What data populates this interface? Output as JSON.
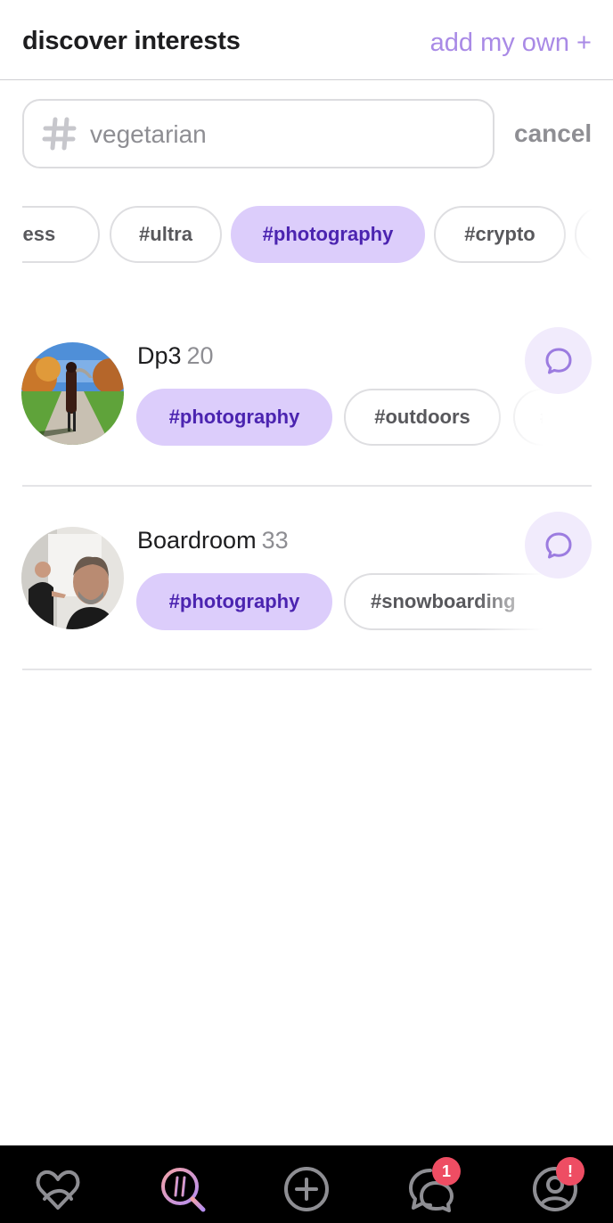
{
  "header": {
    "title": "discover interests",
    "add_own": "add my own +"
  },
  "search": {
    "value": "vegetarian",
    "icon": "hash-icon",
    "cancel": "cancel"
  },
  "filter_chips": [
    {
      "label": "tness",
      "active": false
    },
    {
      "label": "#ultra",
      "active": false
    },
    {
      "label": "#photography",
      "active": true
    },
    {
      "label": "#crypto",
      "active": false
    },
    {
      "label": "",
      "active": false
    }
  ],
  "users": [
    {
      "name": "Dp3",
      "age": "20",
      "tags": [
        {
          "label": "#photography",
          "active": true
        },
        {
          "label": "#outdoors",
          "active": false
        },
        {
          "label": "#",
          "active": false
        }
      ]
    },
    {
      "name": "Boardroom",
      "age": "33",
      "tags": [
        {
          "label": "#photography",
          "active": true
        },
        {
          "label": "#snowboarding",
          "active": false
        }
      ]
    }
  ],
  "tabbar": {
    "items": [
      {
        "icon": "heart-pretzel-icon",
        "active": false
      },
      {
        "icon": "hashtag-search-icon",
        "active": true
      },
      {
        "icon": "plus-circle-icon",
        "active": false
      },
      {
        "icon": "chat-bubbles-icon",
        "active": false,
        "badge": "1"
      },
      {
        "icon": "profile-icon",
        "active": false,
        "badge": "!"
      }
    ]
  },
  "colors": {
    "accent": "#a98ae6",
    "chip_active_bg": "#dccdfb",
    "chip_active_text": "#4b24b0",
    "badge": "#ee4d63",
    "tabbar_bg": "#000000"
  }
}
